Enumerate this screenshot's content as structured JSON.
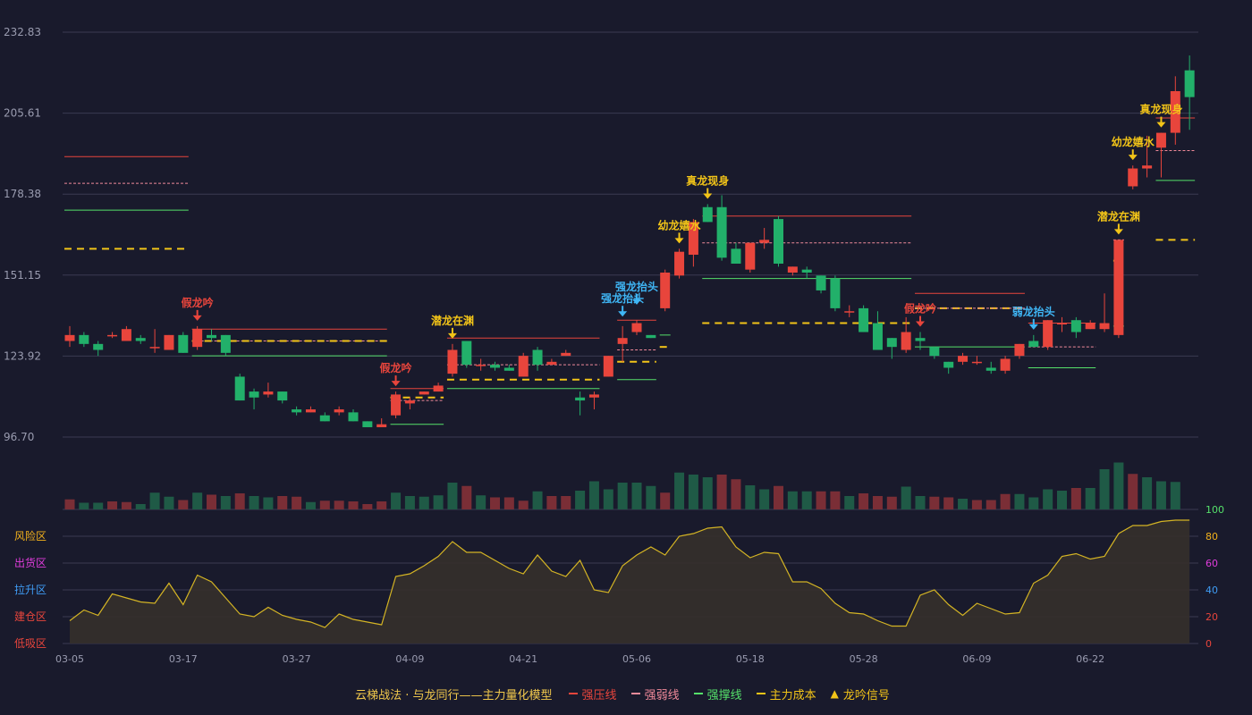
{
  "colors": {
    "background": "#191a2c",
    "grid": "#3a3b52",
    "axis_text": "#9a9cb0",
    "up": "#e8453c",
    "down": "#22b06a",
    "up_volume": "#7a2e36",
    "down_volume": "#1f5a46",
    "strong_press": "#e8453c",
    "strong_weak": "#f08a9a",
    "strong_support": "#55e06a",
    "main_cost": "#f2c418",
    "signal_gold": "#f2c418",
    "signal_red": "#e8453c",
    "signal_blue": "#3fb6f5",
    "osc_line": "#d4b424",
    "osc_fill": "#35302b",
    "zone_risk": "#f2b11c",
    "zone_distribute": "#e03cdc",
    "zone_pullup": "#3f9cf5",
    "zone_build": "#e8453c",
    "zone_low": "#e8453c"
  },
  "chart_data": {
    "type": "candlestick",
    "y_ticks": [
      "232.83",
      "205.61",
      "178.38",
      "151.15",
      "123.92",
      "96.70"
    ],
    "ylim": [
      96.7,
      232.83
    ],
    "x_ticks": [
      {
        "i": 0,
        "label": "03-05"
      },
      {
        "i": 8,
        "label": "03-17"
      },
      {
        "i": 16,
        "label": "03-27"
      },
      {
        "i": 24,
        "label": "04-09"
      },
      {
        "i": 32,
        "label": "04-21"
      },
      {
        "i": 40,
        "label": "05-06"
      },
      {
        "i": 48,
        "label": "05-18"
      },
      {
        "i": 56,
        "label": "05-28"
      },
      {
        "i": 64,
        "label": "06-09"
      },
      {
        "i": 72,
        "label": "06-22"
      }
    ],
    "candles": [
      [
        129,
        131,
        127,
        134
      ],
      [
        131,
        128,
        127,
        132
      ],
      [
        128,
        126,
        124,
        129
      ],
      [
        131,
        131,
        130,
        132
      ],
      [
        129,
        133,
        129,
        134
      ],
      [
        130,
        129,
        128,
        131
      ],
      [
        127,
        127,
        125,
        133
      ],
      [
        126,
        131,
        126,
        131
      ],
      [
        131,
        125,
        125,
        132
      ],
      [
        127,
        133,
        126,
        134
      ],
      [
        131,
        130,
        129,
        133
      ],
      [
        131,
        125,
        124,
        131
      ],
      [
        117,
        109,
        109,
        118
      ],
      [
        112,
        110,
        106,
        113
      ],
      [
        111,
        112,
        110,
        115
      ],
      [
        112,
        109,
        108,
        112
      ],
      [
        106,
        105,
        104,
        107
      ],
      [
        105,
        106,
        105,
        107
      ],
      [
        104,
        102,
        102,
        105
      ],
      [
        105,
        106,
        104,
        107
      ],
      [
        105,
        102,
        102,
        106
      ],
      [
        102,
        100,
        100,
        102
      ],
      [
        100,
        101,
        100,
        103
      ],
      [
        104,
        111,
        103,
        112
      ],
      [
        108,
        109,
        106,
        110
      ],
      [
        111,
        112,
        111,
        112
      ],
      [
        112,
        114,
        112,
        115
      ],
      [
        118,
        126,
        117,
        128
      ],
      [
        129,
        121,
        120,
        129
      ],
      [
        121,
        121,
        119,
        123
      ],
      [
        121,
        120,
        119,
        122
      ],
      [
        120,
        119,
        119,
        121
      ],
      [
        117,
        124,
        117,
        125
      ],
      [
        126,
        121,
        119,
        127
      ],
      [
        121,
        122,
        121,
        123
      ],
      [
        124,
        125,
        124,
        126
      ],
      [
        110,
        109,
        104,
        112
      ],
      [
        110,
        111,
        106,
        112
      ],
      [
        117,
        124,
        117,
        124
      ],
      [
        128,
        130,
        122,
        134
      ],
      [
        132,
        135,
        131,
        136
      ],
      [
        131,
        130,
        130,
        131
      ],
      [
        140,
        152,
        139,
        153
      ],
      [
        151,
        159,
        150,
        160
      ],
      [
        158,
        169,
        154,
        170
      ],
      [
        174,
        169,
        169,
        175
      ],
      [
        174,
        157,
        156,
        178
      ],
      [
        160,
        155,
        155,
        162
      ],
      [
        153,
        162,
        152,
        162
      ],
      [
        162,
        163,
        160,
        167
      ],
      [
        170,
        155,
        154,
        171
      ],
      [
        152,
        154,
        151,
        154
      ],
      [
        153,
        152,
        150,
        154
      ],
      [
        151,
        146,
        145,
        151
      ],
      [
        150,
        140,
        139,
        151
      ],
      [
        139,
        139,
        137,
        141
      ],
      [
        140,
        132,
        132,
        141
      ],
      [
        135,
        126,
        126,
        139
      ],
      [
        130,
        127,
        123,
        130
      ],
      [
        126,
        132,
        125,
        137
      ],
      [
        130,
        129,
        126,
        132
      ],
      [
        127,
        124,
        123,
        127
      ],
      [
        122,
        120,
        118,
        122
      ],
      [
        122,
        124,
        121,
        125
      ],
      [
        122,
        122,
        121,
        124
      ],
      [
        120,
        119,
        118,
        122
      ],
      [
        119,
        123,
        118,
        124
      ],
      [
        124,
        128,
        123,
        128
      ],
      [
        129,
        127,
        127,
        131
      ],
      [
        127,
        136,
        126,
        136
      ],
      [
        135,
        135,
        132,
        137
      ],
      [
        136,
        132,
        130,
        137
      ],
      [
        133,
        135,
        133,
        136
      ],
      [
        133,
        135,
        132,
        145
      ],
      [
        131,
        163,
        130,
        163
      ],
      [
        181,
        187,
        180,
        188
      ],
      [
        187,
        188,
        184,
        198
      ],
      [
        194,
        199,
        184,
        199
      ],
      [
        199,
        213,
        195,
        218
      ],
      [
        220,
        211,
        200,
        225
      ]
    ],
    "volume": [
      [
        0.15,
        1
      ],
      [
        0.1,
        0
      ],
      [
        0.1,
        0
      ],
      [
        0.12,
        1
      ],
      [
        0.11,
        1
      ],
      [
        0.08,
        0
      ],
      [
        0.25,
        0
      ],
      [
        0.19,
        0
      ],
      [
        0.14,
        1
      ],
      [
        0.25,
        0
      ],
      [
        0.22,
        1
      ],
      [
        0.2,
        0
      ],
      [
        0.24,
        1
      ],
      [
        0.2,
        0
      ],
      [
        0.18,
        0
      ],
      [
        0.2,
        1
      ],
      [
        0.19,
        1
      ],
      [
        0.11,
        0
      ],
      [
        0.13,
        1
      ],
      [
        0.13,
        1
      ],
      [
        0.12,
        1
      ],
      [
        0.08,
        1
      ],
      [
        0.12,
        1
      ],
      [
        0.25,
        0
      ],
      [
        0.2,
        0
      ],
      [
        0.19,
        0
      ],
      [
        0.21,
        0
      ],
      [
        0.4,
        0
      ],
      [
        0.35,
        1
      ],
      [
        0.21,
        0
      ],
      [
        0.18,
        1
      ],
      [
        0.18,
        1
      ],
      [
        0.13,
        1
      ],
      [
        0.27,
        0
      ],
      [
        0.2,
        1
      ],
      [
        0.2,
        1
      ],
      [
        0.28,
        0
      ],
      [
        0.42,
        0
      ],
      [
        0.3,
        0
      ],
      [
        0.4,
        0
      ],
      [
        0.4,
        0
      ],
      [
        0.35,
        0
      ],
      [
        0.25,
        1
      ],
      [
        0.55,
        0
      ],
      [
        0.52,
        0
      ],
      [
        0.48,
        0
      ],
      [
        0.52,
        1
      ],
      [
        0.45,
        1
      ],
      [
        0.36,
        0
      ],
      [
        0.3,
        0
      ],
      [
        0.35,
        1
      ],
      [
        0.27,
        0
      ],
      [
        0.27,
        0
      ],
      [
        0.27,
        1
      ],
      [
        0.27,
        1
      ],
      [
        0.2,
        0
      ],
      [
        0.24,
        1
      ],
      [
        0.2,
        1
      ],
      [
        0.19,
        1
      ],
      [
        0.34,
        0
      ],
      [
        0.2,
        0
      ],
      [
        0.19,
        1
      ],
      [
        0.18,
        1
      ],
      [
        0.16,
        0
      ],
      [
        0.14,
        1
      ],
      [
        0.14,
        1
      ],
      [
        0.23,
        1
      ],
      [
        0.23,
        0
      ],
      [
        0.18,
        0
      ],
      [
        0.3,
        0
      ],
      [
        0.28,
        0
      ],
      [
        0.32,
        1
      ],
      [
        0.32,
        0
      ],
      [
        0.6,
        0
      ],
      [
        0.7,
        0
      ],
      [
        0.53,
        1
      ],
      [
        0.48,
        0
      ],
      [
        0.42,
        0
      ],
      [
        0.41,
        0
      ]
    ],
    "oscillator": {
      "scale_ticks": [
        "100",
        "80",
        "60",
        "40",
        "20",
        "0"
      ],
      "zones": [
        "风险区",
        "出货区",
        "拉升区",
        "建仓区",
        "低吸区"
      ],
      "values": [
        17,
        25,
        21,
        37,
        34,
        31,
        30,
        45,
        29,
        51,
        46,
        34,
        22,
        20,
        27,
        21,
        18,
        16,
        12,
        22,
        18,
        16,
        14,
        50,
        52,
        58,
        65,
        76,
        68,
        68,
        62,
        56,
        52,
        66,
        54,
        50,
        62,
        40,
        38,
        58,
        66,
        72,
        66,
        80,
        82,
        86,
        87,
        72,
        64,
        68,
        67,
        46,
        46,
        41,
        30,
        23,
        22,
        17,
        13,
        13,
        36,
        40,
        29,
        21,
        30,
        26,
        22,
        23,
        45,
        51,
        65,
        67,
        63,
        65,
        82,
        88,
        88,
        91,
        92,
        92
      ]
    },
    "levels": [
      {
        "kind": "strong_press",
        "value": 191,
        "from": 0,
        "to": 8
      },
      {
        "kind": "strong_weak",
        "value": 182,
        "from": 0,
        "to": 8
      },
      {
        "kind": "strong_support",
        "value": 173,
        "from": 0,
        "to": 8
      },
      {
        "kind": "main_cost",
        "value": 160,
        "from": 0,
        "to": 8
      },
      {
        "kind": "strong_press",
        "value": 133,
        "from": 9,
        "to": 22
      },
      {
        "kind": "strong_weak",
        "value": 129,
        "from": 9,
        "to": 22
      },
      {
        "kind": "main_cost",
        "value": 129,
        "from": 9,
        "to": 22
      },
      {
        "kind": "strong_support",
        "value": 124,
        "from": 9,
        "to": 22
      },
      {
        "kind": "strong_press",
        "value": 113,
        "from": 23,
        "to": 26
      },
      {
        "kind": "main_cost",
        "value": 110,
        "from": 23,
        "to": 26
      },
      {
        "kind": "strong_weak",
        "value": 109,
        "from": 23,
        "to": 26
      },
      {
        "kind": "strong_support",
        "value": 101,
        "from": 23,
        "to": 26
      },
      {
        "kind": "strong_press",
        "value": 130,
        "from": 27,
        "to": 37
      },
      {
        "kind": "strong_weak",
        "value": 121,
        "from": 27,
        "to": 37
      },
      {
        "kind": "main_cost",
        "value": 116,
        "from": 27,
        "to": 37
      },
      {
        "kind": "strong_support",
        "value": 113,
        "from": 27,
        "to": 37
      },
      {
        "kind": "strong_press",
        "value": 136,
        "from": 39,
        "to": 41
      },
      {
        "kind": "strong_weak",
        "value": 126,
        "from": 39,
        "to": 41
      },
      {
        "kind": "main_cost",
        "value": 122,
        "from": 39,
        "to": 41
      },
      {
        "kind": "strong_support",
        "value": 116,
        "from": 39,
        "to": 41
      },
      {
        "kind": "strong_support",
        "value": 131,
        "from": 42,
        "to": 42
      },
      {
        "kind": "main_cost",
        "value": 127,
        "from": 42,
        "to": 42
      },
      {
        "kind": "strong_press",
        "value": 171,
        "from": 45,
        "to": 59
      },
      {
        "kind": "strong_weak",
        "value": 162,
        "from": 45,
        "to": 59
      },
      {
        "kind": "strong_support",
        "value": 150,
        "from": 45,
        "to": 59
      },
      {
        "kind": "main_cost",
        "value": 135,
        "from": 45,
        "to": 59
      },
      {
        "kind": "strong_press",
        "value": 145,
        "from": 60,
        "to": 67
      },
      {
        "kind": "main_cost",
        "value": 140,
        "from": 60,
        "to": 67
      },
      {
        "kind": "strong_weak",
        "value": 140,
        "from": 60,
        "to": 67
      },
      {
        "kind": "strong_support",
        "value": 127,
        "from": 60,
        "to": 67
      },
      {
        "kind": "strong_press",
        "value": 135,
        "from": 68,
        "to": 72
      },
      {
        "kind": "strong_weak",
        "value": 127,
        "from": 68,
        "to": 72
      },
      {
        "kind": "strong_support",
        "value": 120,
        "from": 68,
        "to": 72
      },
      {
        "kind": "strong_weak",
        "value": 163,
        "from": 74,
        "to": 74
      },
      {
        "kind": "main_cost",
        "value": 156,
        "from": 74,
        "to": 74
      },
      {
        "kind": "strong_support",
        "value": 134,
        "from": 74,
        "to": 74
      },
      {
        "kind": "strong_press",
        "value": 204,
        "from": 77,
        "to": 79
      },
      {
        "kind": "strong_weak",
        "value": 193,
        "from": 77,
        "to": 79
      },
      {
        "kind": "strong_support",
        "value": 183,
        "from": 77,
        "to": 79
      },
      {
        "kind": "main_cost",
        "value": 163,
        "from": 77,
        "to": 79
      }
    ],
    "signals": [
      {
        "i": 9,
        "label": "假龙吟",
        "kind": "red",
        "dir": "down"
      },
      {
        "i": 23,
        "label": "假龙吟",
        "kind": "red",
        "dir": "down"
      },
      {
        "i": 27,
        "label": "潜龙在渊",
        "kind": "gold",
        "dir": "down"
      },
      {
        "i": 39,
        "label": "强龙抬头",
        "kind": "blue",
        "dir": "down"
      },
      {
        "i": 40,
        "label": "强龙抬头",
        "kind": "blue",
        "dir": "down"
      },
      {
        "i": 43,
        "label": "幼龙嬉水",
        "kind": "gold",
        "dir": "down"
      },
      {
        "i": 45,
        "label": "真龙现身",
        "kind": "gold",
        "dir": "down"
      },
      {
        "i": 60,
        "label": "假龙吟",
        "kind": "red",
        "dir": "down"
      },
      {
        "i": 68,
        "label": "弱龙抬头",
        "kind": "blue",
        "dir": "down"
      },
      {
        "i": 74,
        "label": "潜龙在渊",
        "kind": "gold",
        "dir": "down"
      },
      {
        "i": 75,
        "label": "幼龙嬉水",
        "kind": "gold",
        "dir": "down"
      },
      {
        "i": 77,
        "label": "真龙现身",
        "kind": "gold",
        "dir": "down"
      }
    ]
  },
  "legend": {
    "title": "云梯战法 · 与龙同行——主力量化模型",
    "items": [
      {
        "label": "强压线",
        "color": "#e8453c",
        "style": "solid"
      },
      {
        "label": "强弱线",
        "color": "#f08a9a",
        "style": "dashed"
      },
      {
        "label": "强撑线",
        "color": "#55e06a",
        "style": "solid"
      },
      {
        "label": "主力成本",
        "color": "#f2c418",
        "style": "dashed"
      },
      {
        "label": "龙吟信号",
        "color": "#f2c418",
        "style": "triangle"
      }
    ]
  }
}
